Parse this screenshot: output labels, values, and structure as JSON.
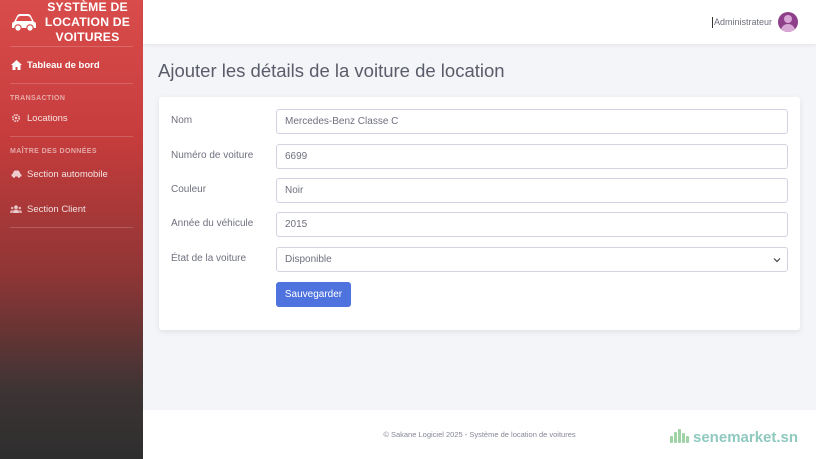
{
  "sidebar": {
    "brand": {
      "title": "SYSTÈME DE LOCATION DE VOITURES",
      "icon": "car-icon"
    },
    "items": [
      {
        "label": "Tableau de bord",
        "icon": "home-icon",
        "active": true
      },
      {
        "heading": "TRANSACTION"
      },
      {
        "label": "Locations",
        "icon": "gear-icon"
      },
      {
        "heading": "MAÎTRE DES DONNÉES"
      },
      {
        "label": "Section automobile",
        "icon": "car-small-icon"
      },
      {
        "label": "Section Client",
        "icon": "users-icon"
      }
    ]
  },
  "topbar": {
    "user_name": "Administrateur",
    "avatar_color": "#8e3f8a"
  },
  "main": {
    "title": "Ajouter les détails de la voiture de location",
    "form": {
      "fields": [
        {
          "label": "Nom",
          "value": "Mercedes-Benz Classe C"
        },
        {
          "label": "Numéro de voiture",
          "value": "6699"
        },
        {
          "label": "Couleur",
          "value": "Noir"
        },
        {
          "label": "Année du véhicule",
          "value": "2015"
        },
        {
          "label": "État de la voiture",
          "value": "Disponible"
        }
      ],
      "submit_label": "Sauvegarder"
    }
  },
  "footer": {
    "text": "© Sakane Logiciel 2025 - Système de location de voitures"
  },
  "watermark": {
    "text": "senemarket.sn"
  },
  "colors": {
    "primary": "#4e73df",
    "sidebar_top": "#d94c4c",
    "sidebar_bottom": "#2e2e2e"
  }
}
